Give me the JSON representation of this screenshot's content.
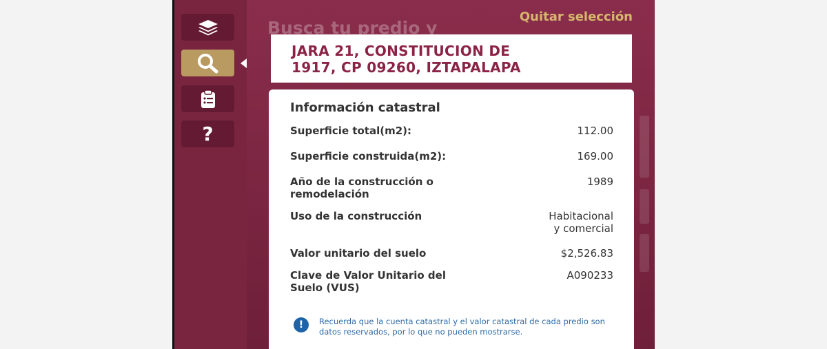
{
  "quitar_label": "Quitar selección",
  "background_title": "Busca tu predio y",
  "address": {
    "line1": "JARA 21, CONSTITUCION DE",
    "line2": "1917, CP 09260, IZTAPALAPA"
  },
  "sidebar": {
    "items": [
      {
        "icon": "layers-icon",
        "active": false
      },
      {
        "icon": "search-icon",
        "active": true
      },
      {
        "icon": "clipboard-icon",
        "active": false
      },
      {
        "icon": "help-icon",
        "label": "?",
        "active": false
      }
    ]
  },
  "info": {
    "title": "Información catastral",
    "rows": [
      {
        "label": "Superficie total(m2):",
        "value": "112.00"
      },
      {
        "label": "Superficie construida(m2):",
        "value": "169.00"
      },
      {
        "label_1": "Año de la construcción o",
        "label_2": "remodelación",
        "value": "1989"
      },
      {
        "label": "Uso de la construcción",
        "value_1": "Habitacional",
        "value_2": "y comercial"
      },
      {
        "label": "Valor unitario del suelo",
        "value": "$2,526.83"
      },
      {
        "label_1": "Clave de Valor Unitario del",
        "label_2": "Suelo (VUS)",
        "value": "A090233"
      }
    ],
    "notice_icon": "!",
    "notice": "Recuerda que la cuenta catastral y el valor catastral de cada predio son datos reservados, por lo que no pueden mostrarse."
  },
  "colors": {
    "sidebar": "#7a2540",
    "button": "#641a33",
    "active_button": "#b99a61",
    "accent": "#d7b66d",
    "address_text": "#8b2347",
    "notice": "#2b6aa8"
  }
}
